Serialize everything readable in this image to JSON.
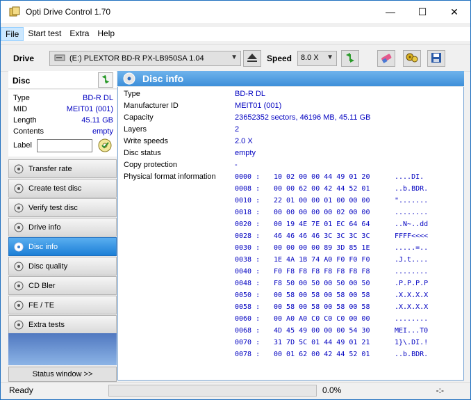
{
  "app": {
    "title": "Opti Drive Control 1.70"
  },
  "window_controls": {
    "minimize": "—",
    "maximize": "☐",
    "close": "✕"
  },
  "menu": [
    "File",
    "Start test",
    "Extra",
    "Help"
  ],
  "toolbar": {
    "drive_label": "Drive",
    "drive_value": "(E:)   PLEXTOR BD-R  PX-LB950SA 1.04",
    "speed_label": "Speed",
    "speed_value": "8.0 X"
  },
  "disc_panel": {
    "title": "Disc",
    "props": [
      {
        "k": "Type",
        "v": "BD-R DL"
      },
      {
        "k": "MID",
        "v": "MEIT01 (001)"
      },
      {
        "k": "Length",
        "v": "45.11 GB"
      },
      {
        "k": "Contents",
        "v": "empty"
      }
    ],
    "label_key": "Label",
    "label_value": ""
  },
  "nav": [
    {
      "label": "Transfer rate",
      "active": false
    },
    {
      "label": "Create test disc",
      "active": false
    },
    {
      "label": "Verify test disc",
      "active": false
    },
    {
      "label": "Drive info",
      "active": false
    },
    {
      "label": "Disc info",
      "active": true
    },
    {
      "label": "Disc quality",
      "active": false
    },
    {
      "label": "CD Bler",
      "active": false
    },
    {
      "label": "FE / TE",
      "active": false
    },
    {
      "label": "Extra tests",
      "active": false
    }
  ],
  "status_window_label": "Status window >>",
  "main": {
    "title": "Disc info",
    "info": [
      {
        "k": "Type",
        "v": "BD-R DL"
      },
      {
        "k": "Manufacturer ID",
        "v": "MEIT01 (001)"
      },
      {
        "k": "Capacity",
        "v": "23652352 sectors, 46196 MB, 45.11 GB"
      },
      {
        "k": "Layers",
        "v": "2"
      },
      {
        "k": "Write speeds",
        "v": "2.0 X"
      },
      {
        "k": "Disc status",
        "v": "empty"
      },
      {
        "k": "Copy protection",
        "v": "-"
      },
      {
        "k": "Physical format information",
        "v": ""
      }
    ],
    "hex": [
      {
        "addr": "0000 :",
        "bytes": "10 02 00 00 44 49 01 20",
        "ascii": "....DI. "
      },
      {
        "addr": "0008 :",
        "bytes": "00 00 62 00 42 44 52 01",
        "ascii": "..b.BDR."
      },
      {
        "addr": "0010 :",
        "bytes": "22 01 00 00 01 00 00 00",
        "ascii": "\"......."
      },
      {
        "addr": "0018 :",
        "bytes": "00 00 00 00 00 02 00 00",
        "ascii": "........"
      },
      {
        "addr": "0020 :",
        "bytes": "00 19 4E 7E 01 EC 64 64",
        "ascii": "..N~..dd"
      },
      {
        "addr": "0028 :",
        "bytes": "46 46 46 46 3C 3C 3C 3C",
        "ascii": "FFFF<<<<"
      },
      {
        "addr": "0030 :",
        "bytes": "00 00 00 00 89 3D 85 1E",
        "ascii": ".....=.."
      },
      {
        "addr": "0038 :",
        "bytes": "1E 4A 1B 74 A0 F0 F0 F0",
        "ascii": ".J.t...."
      },
      {
        "addr": "0040 :",
        "bytes": "F0 F8 F8 F8 F8 F8 F8 F8",
        "ascii": "........"
      },
      {
        "addr": "0048 :",
        "bytes": "F8 50 00 50 00 50 00 50",
        "ascii": ".P.P.P.P"
      },
      {
        "addr": "0050 :",
        "bytes": "00 58 00 58 00 58 00 58",
        "ascii": ".X.X.X.X"
      },
      {
        "addr": "0058 :",
        "bytes": "00 58 00 58 00 58 00 58",
        "ascii": ".X.X.X.X"
      },
      {
        "addr": "0060 :",
        "bytes": "00 A0 A0 C0 C0 C0 00 00",
        "ascii": "........"
      },
      {
        "addr": "0068 :",
        "bytes": "4D 45 49 00 00 00 54 30",
        "ascii": "MEI...T0"
      },
      {
        "addr": "0070 :",
        "bytes": "31 7D 5C 01 44 49 01 21",
        "ascii": "1}\\.DI.!"
      },
      {
        "addr": "0078 :",
        "bytes": "00 01 62 00 42 44 52 01",
        "ascii": "..b.BDR."
      }
    ]
  },
  "statusbar": {
    "ready": "Ready",
    "percent": "0.0%",
    "progress": 0.0,
    "time": "-:-"
  }
}
